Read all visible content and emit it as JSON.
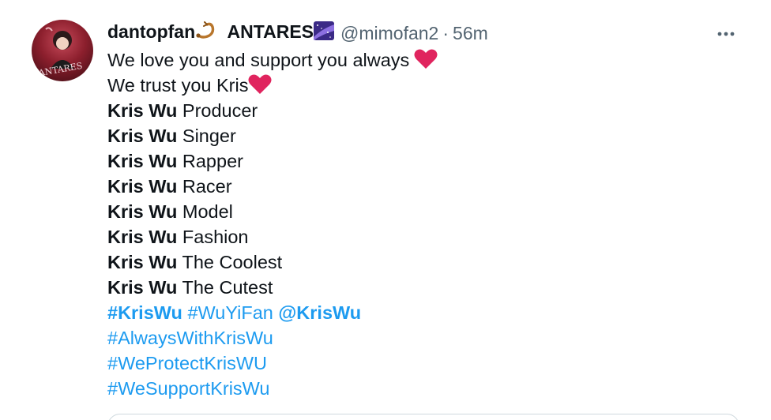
{
  "tweet": {
    "display_name": "dantopfan",
    "display_name_suffix": "ANTARES",
    "handle": "@mimofan2",
    "separator": "·",
    "time": "56m",
    "avatar_text": "ANTARES",
    "lines": [
      {
        "plain": "We love you and support you always",
        "emoji": "heart"
      },
      {
        "plain": "We trust you Kris",
        "emoji": "heart"
      },
      {
        "bold": "Kris Wu",
        "plain": "Producer"
      },
      {
        "bold": "Kris Wu",
        "plain": "Singer"
      },
      {
        "bold": "Kris Wu",
        "plain": "Rapper"
      },
      {
        "bold": "Kris Wu",
        "plain": "Racer"
      },
      {
        "bold": "Kris Wu",
        "plain": "Model"
      },
      {
        "bold": "Kris Wu",
        "plain": "Fashion"
      },
      {
        "bold": "Kris Wu",
        "plain": "The Coolest"
      },
      {
        "bold": "Kris Wu",
        "plain": "The Cutest"
      }
    ],
    "hashtag_line_1": {
      "tag1": "#KrisWu",
      "tag2": "#WuYiFan",
      "mention": "@KrisWu"
    },
    "hashtags": [
      "#AlwaysWithKrisWu",
      "#WeProtectKrisWU",
      "#WeSupportKrisWu"
    ]
  },
  "icons": {
    "more": "more-horizontal-icon",
    "scorpion": "scorpion-emoji",
    "galaxy": "milky-way-emoji",
    "heart": "red-heart-emoji"
  },
  "colors": {
    "link": "#1d9bf0",
    "secondary_text": "#536471",
    "heart": "#e0245e"
  }
}
